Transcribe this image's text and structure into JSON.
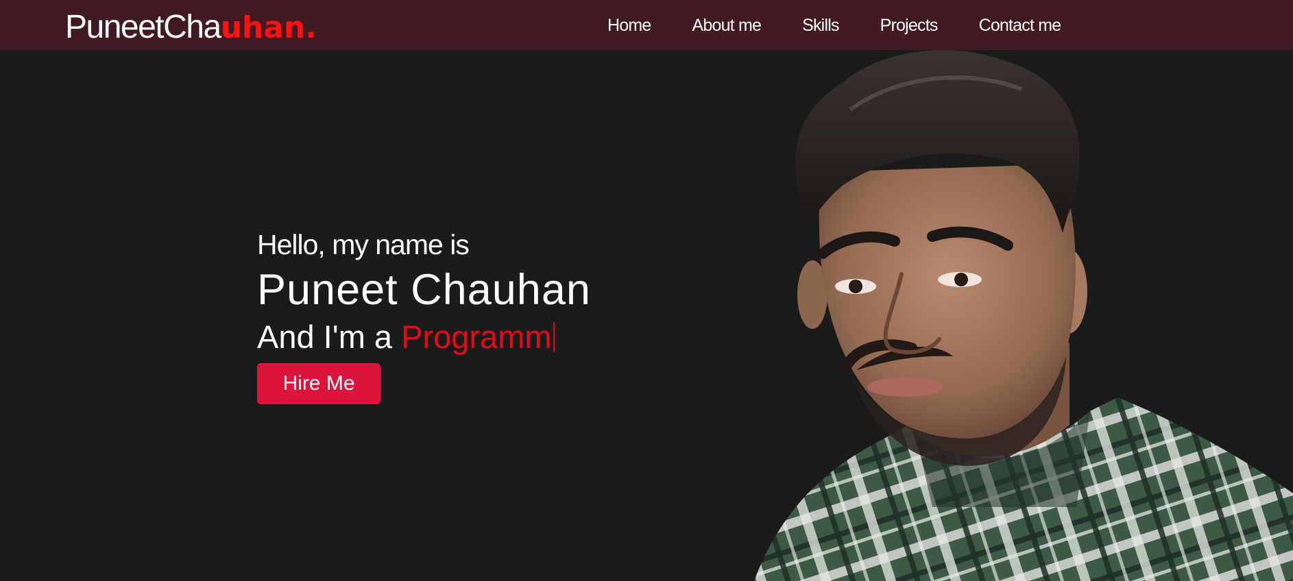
{
  "brand": {
    "prefix": "PuneetCha",
    "accent": "uhan."
  },
  "nav": {
    "items": [
      {
        "label": "Home"
      },
      {
        "label": "About me"
      },
      {
        "label": "Skills"
      },
      {
        "label": "Projects"
      },
      {
        "label": "Contact me"
      }
    ]
  },
  "hero": {
    "greeting": "Hello, my name is",
    "name": "Puneet Chauhan",
    "role_prefix": "And I'm a ",
    "role_typed": "Programm",
    "hire_label": "Hire Me"
  },
  "colors": {
    "navbar_bg": "#421b22",
    "page_bg": "#1b1b1b",
    "accent_red": "#ff1111",
    "button_bg": "#dc143c",
    "typed_text": "#e30b1a"
  },
  "icons": {
    "portrait": "person-portrait-photo"
  }
}
